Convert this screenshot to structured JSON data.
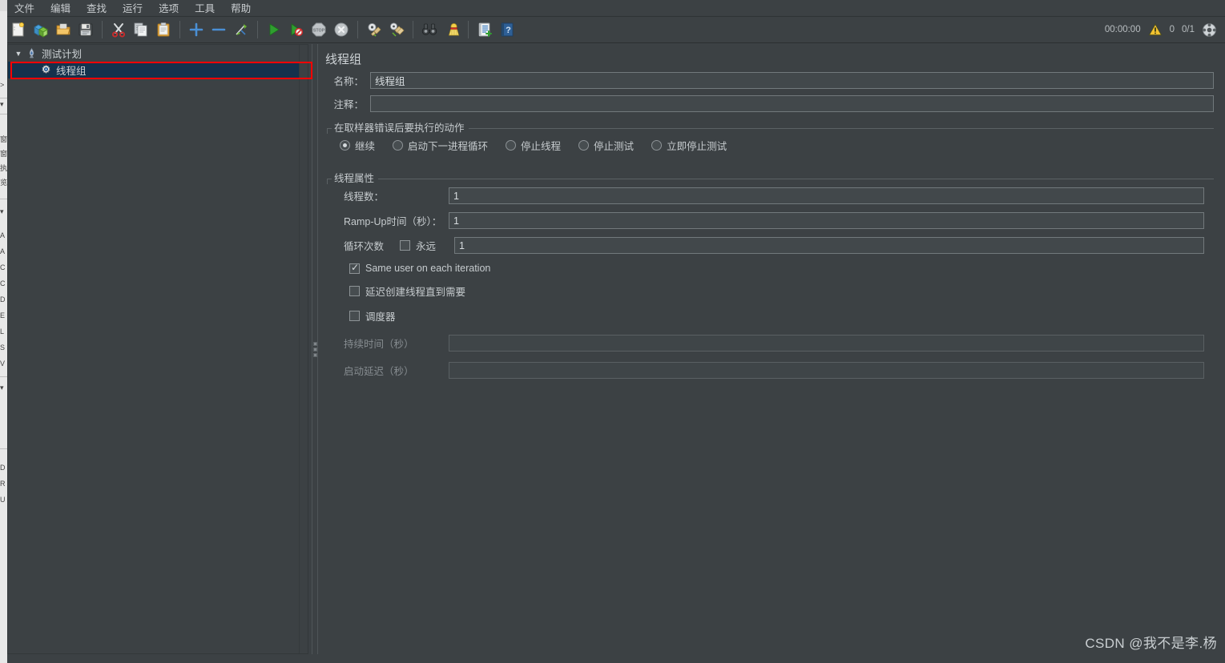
{
  "app": {
    "window_background": "#3c4144",
    "accent_selection": "#15314c",
    "annotation_color": "#fe0000"
  },
  "menubar": {
    "items": [
      {
        "label": "文件",
        "name": "menu-file"
      },
      {
        "label": "编辑",
        "name": "menu-edit"
      },
      {
        "label": "查找",
        "name": "menu-search"
      },
      {
        "label": "运行",
        "name": "menu-run"
      },
      {
        "label": "选项",
        "name": "menu-options"
      },
      {
        "label": "工具",
        "name": "menu-tools"
      },
      {
        "label": "帮助",
        "name": "menu-help"
      }
    ]
  },
  "toolbar": {
    "buttons": [
      {
        "icon": "new-document-icon",
        "tooltip": "新建"
      },
      {
        "icon": "templates-icon",
        "tooltip": "模板"
      },
      {
        "icon": "open-folder-icon",
        "tooltip": "打开"
      },
      {
        "icon": "save-floppy-icon",
        "tooltip": "保存"
      },
      {
        "icon": "cut-scissors-icon",
        "tooltip": "剪切"
      },
      {
        "icon": "copy-icon",
        "tooltip": "复制"
      },
      {
        "icon": "paste-clipboard-icon",
        "tooltip": "粘贴"
      },
      {
        "icon": "expand-plus-icon",
        "tooltip": "展开"
      },
      {
        "icon": "collapse-minus-icon",
        "tooltip": "折叠"
      },
      {
        "icon": "toggle-enable-icon",
        "tooltip": "切换"
      },
      {
        "icon": "start-play-icon",
        "tooltip": "启动"
      },
      {
        "icon": "start-no-timers-icon",
        "tooltip": "无间隔启动"
      },
      {
        "icon": "stop-sign-icon",
        "tooltip": "停止"
      },
      {
        "icon": "shutdown-icon",
        "tooltip": "关闭"
      },
      {
        "icon": "clear-icon",
        "tooltip": "清除"
      },
      {
        "icon": "clear-all-icon",
        "tooltip": "清除全部"
      },
      {
        "icon": "search-binoculars-icon",
        "tooltip": "查找"
      },
      {
        "icon": "reset-search-broom-icon",
        "tooltip": "重置查找"
      },
      {
        "icon": "function-helper-icon",
        "tooltip": "函数助手"
      },
      {
        "icon": "help-book-icon",
        "tooltip": "帮助"
      }
    ],
    "status": {
      "elapsed": "00:00:00",
      "warning_icon": "warning-triangle-icon",
      "warning_count": "0",
      "threads": "0/1",
      "activity_icon": "activity-indicator-icon"
    }
  },
  "tree": {
    "vertical_scrollbar": "tree-vertical-scrollbar",
    "nodes": [
      {
        "label": "测试计划",
        "icon": "test-plan-icon",
        "expanded": true,
        "toggle_glyph": "▼",
        "selected": false,
        "depth": 0
      },
      {
        "label": "线程组",
        "icon": "thread-group-gear-icon",
        "expanded": false,
        "toggle_glyph": "",
        "selected": true,
        "depth": 1
      }
    ]
  },
  "splitter": {
    "name": "panel-splitter",
    "dots": 3
  },
  "content": {
    "title": "线程组",
    "name_field": {
      "label": "名称：",
      "value": "线程组",
      "placeholder": ""
    },
    "comment_field": {
      "label": "注释：",
      "value": "",
      "placeholder": ""
    },
    "error_action_group": {
      "legend": "在取样器错误后要执行的动作",
      "options": [
        {
          "label": "继续",
          "checked": true
        },
        {
          "label": "启动下一进程循环",
          "checked": false
        },
        {
          "label": "停止线程",
          "checked": false
        },
        {
          "label": "停止测试",
          "checked": false
        },
        {
          "label": "立即停止测试",
          "checked": false
        }
      ]
    },
    "thread_properties_group": {
      "legend": "线程属性",
      "fields": [
        {
          "label": "线程数：",
          "value": "1",
          "disabled": false
        },
        {
          "label": "Ramp-Up时间（秒）：",
          "value": "1",
          "disabled": false
        }
      ],
      "loops": {
        "label": "循环次数",
        "forever_label": "永远",
        "forever_checked": false,
        "value": "1"
      },
      "checkboxes": [
        {
          "label": "Same user on each iteration",
          "checked": true
        },
        {
          "label": "延迟创建线程直到需要",
          "checked": false
        },
        {
          "label": "调度器",
          "checked": false
        }
      ],
      "scheduler_fields": [
        {
          "label": "持续时间（秒）",
          "value": "",
          "disabled": true
        },
        {
          "label": "启动延迟（秒）",
          "value": "",
          "disabled": true
        }
      ]
    }
  },
  "behind_window": {
    "fragments": [
      "窗",
      "窗",
      "执",
      "览",
      "A",
      "A",
      "C",
      "C",
      "D",
      "E",
      "L",
      "S",
      "V",
      "D",
      "R",
      "U"
    ]
  },
  "watermark": {
    "text": "CSDN @我不是李.杨"
  }
}
